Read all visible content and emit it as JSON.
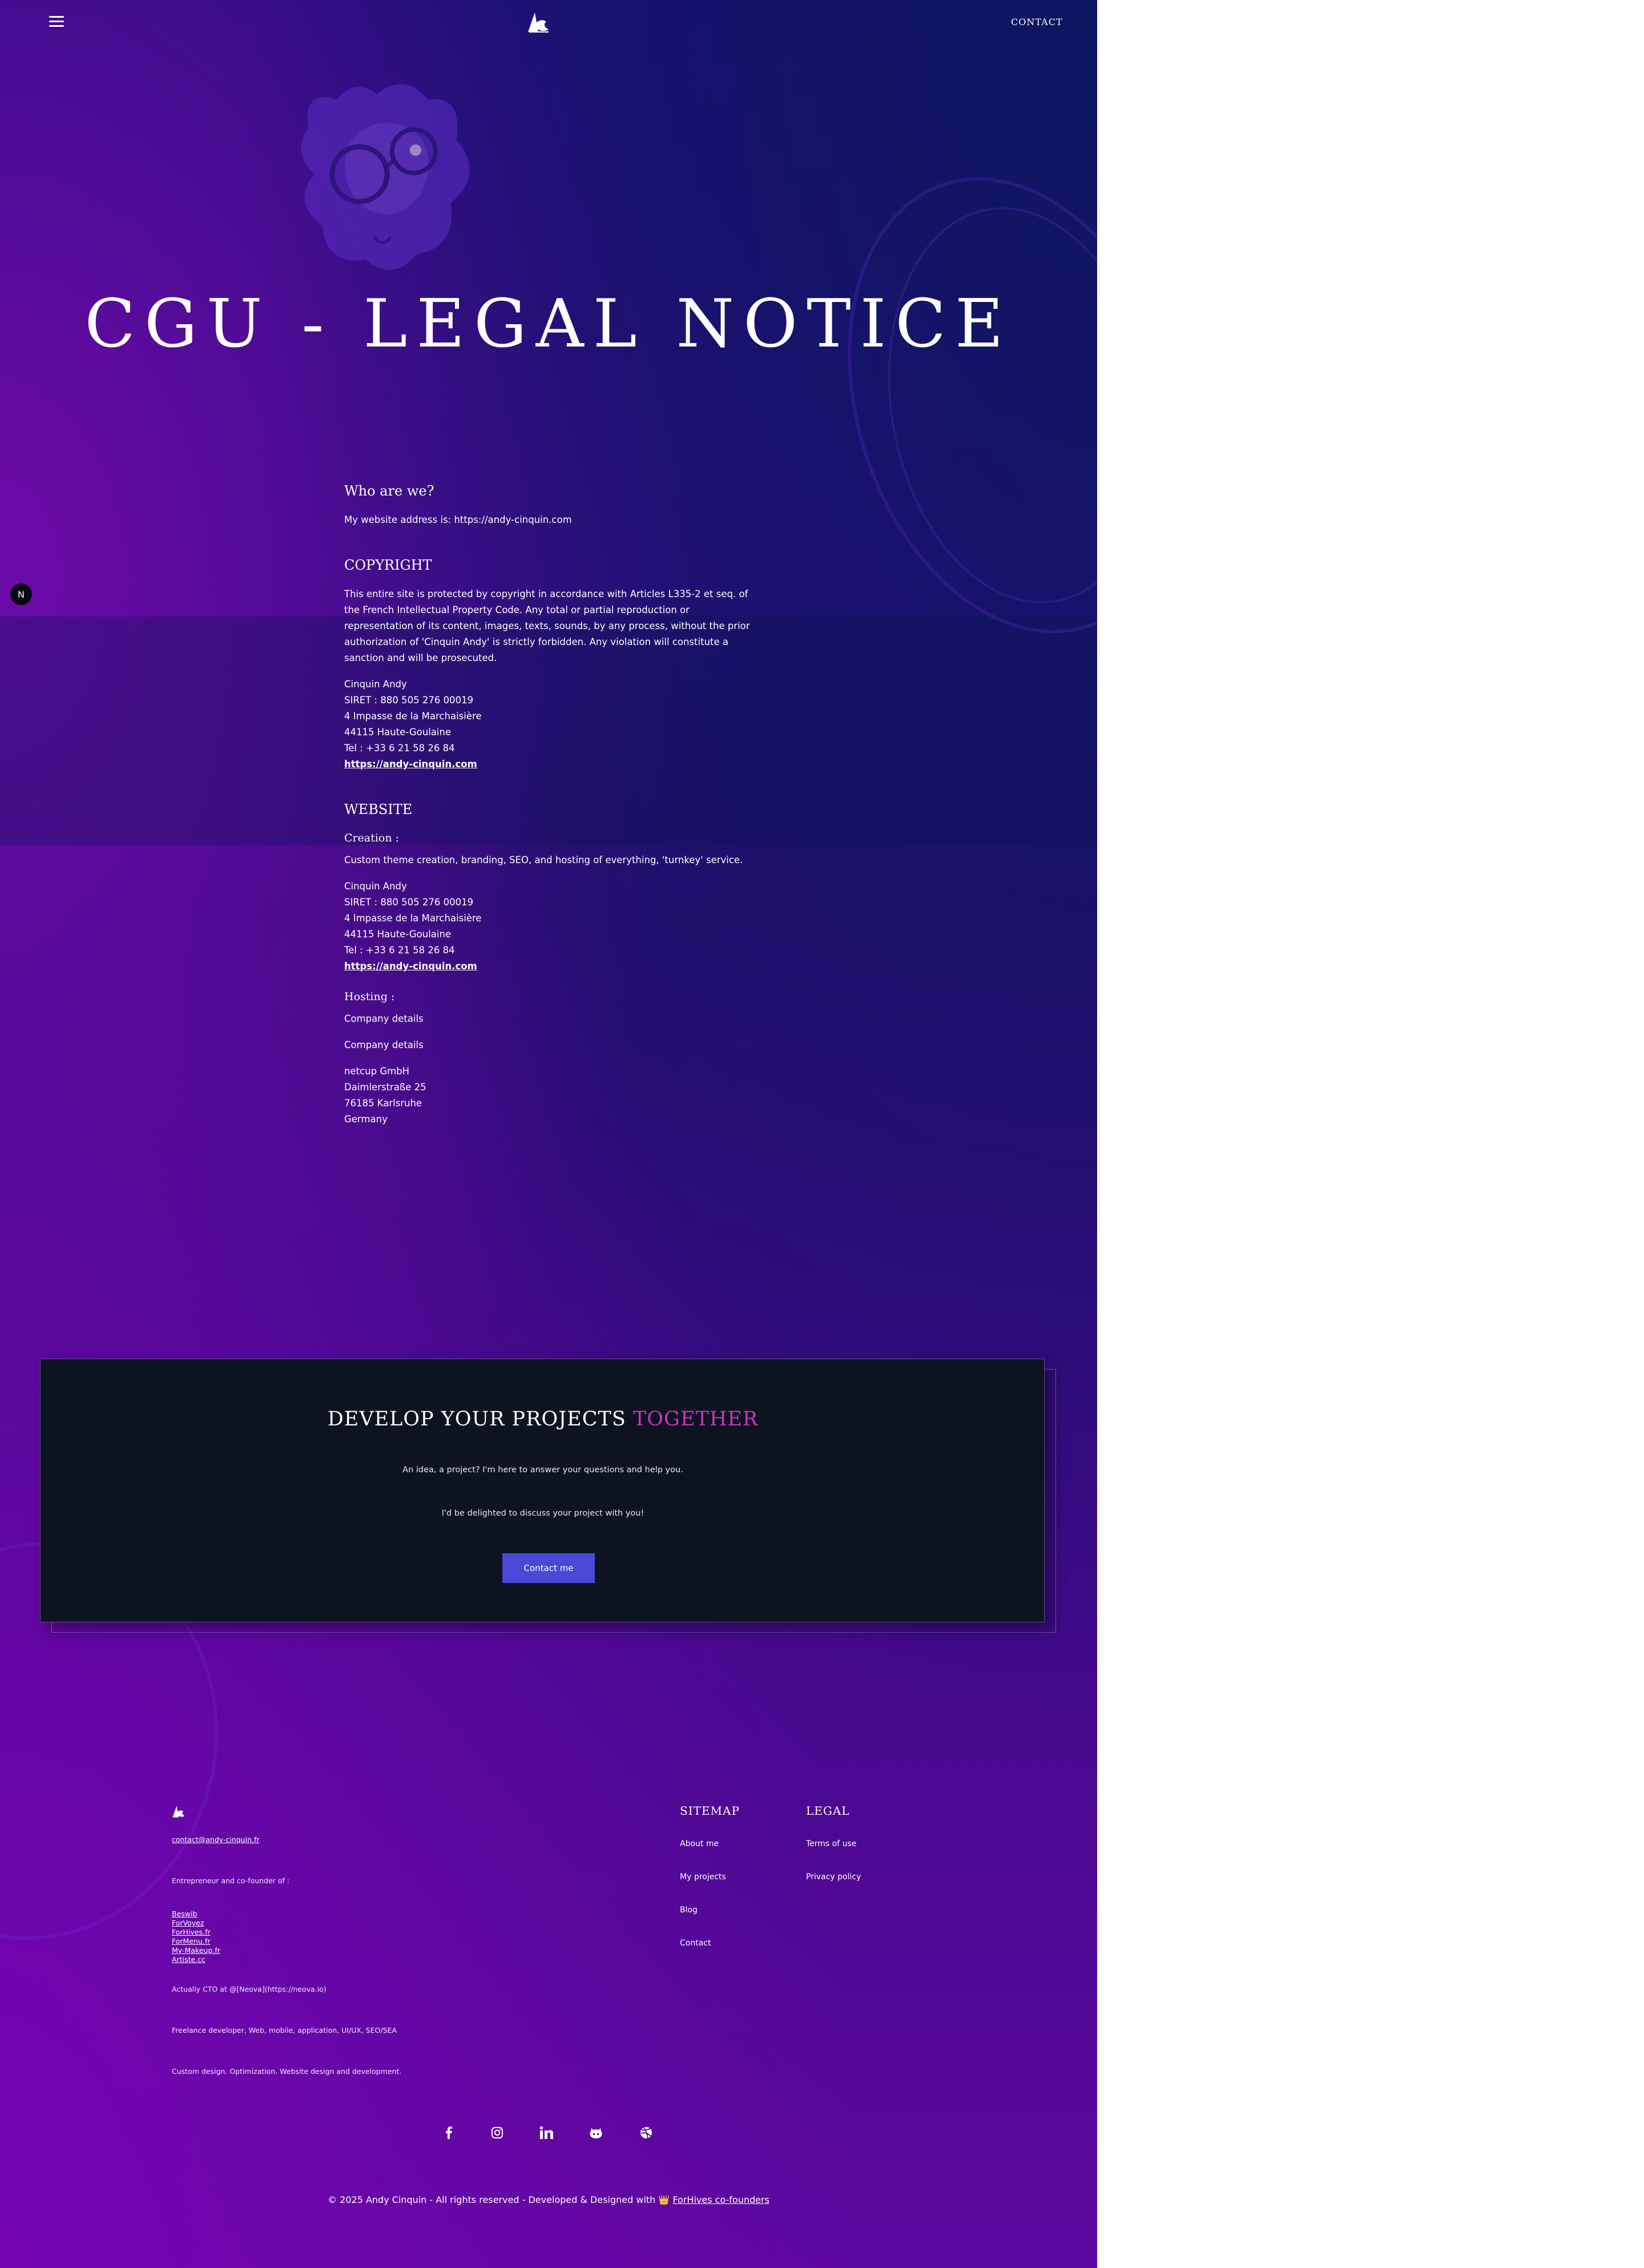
{
  "header": {
    "menu_icon": "hamburger-icon",
    "logo_icon": "ac-logo-icon",
    "contact_label": "CONTACT"
  },
  "hero": {
    "title": "CGU - LEGAL NOTICE"
  },
  "sections": {
    "who": {
      "heading": "Who are we?",
      "text": "My website address is: https://andy-cinquin.com"
    },
    "copyright": {
      "heading": "COPYRIGHT",
      "text": "This entire site is protected by copyright in accordance with Articles L335-2 et seq. of the French Intellectual Property Code. Any total or partial reproduction or representation of its content, images, texts, sounds, by any process, without the prior authorization of 'Cinquin Andy' is strictly forbidden. Any violation will constitute a sanction and will be prosecuted.",
      "name": "Cinquin Andy",
      "siret": "SIRET : 880 505 276 00019",
      "street": "4 Impasse de la Marchaisière",
      "city": "44115 Haute-Goulaine",
      "tel": "Tel : +33 6 21 58 26 84",
      "url": "https://andy-cinquin.com"
    },
    "website": {
      "heading": "WEBSITE",
      "creation_heading": "Creation :",
      "creation_text": "Custom theme creation, branding, SEO, and hosting of everything, 'turnkey' service.",
      "name": "Cinquin Andy",
      "siret": "SIRET : 880 505 276 00019",
      "street": "4 Impasse de la Marchaisière",
      "city": "44115 Haute-Goulaine",
      "tel": "Tel : +33 6 21 58 26 84",
      "url": "https://andy-cinquin.com",
      "hosting_heading": "Hosting :",
      "company_details_1": "Company details",
      "company_details_2": "Company details",
      "host_name": "netcup GmbH",
      "host_street": "Daimlerstraße 25",
      "host_city": "76185 Karlsruhe",
      "host_country": "Germany"
    }
  },
  "floating_badge": "N",
  "cta": {
    "title_main": "DEVELOP YOUR PROJECTS ",
    "title_accent": "TOGETHER",
    "line1": "An idea, a project? I'm here to answer your questions and help you.",
    "line2": "I'd be delighted to discuss your project with you!",
    "button_label": "Contact me"
  },
  "footer": {
    "email": "contact@andy-cinquin.fr",
    "cofounder_label": "Entrepreneur and co-founder of :",
    "ventures": [
      "Beswib",
      "ForVoyez",
      "ForHives.fr",
      "ForMenu.fr",
      "My-Makeup.fr",
      "Artiste.cc"
    ],
    "cto_line": "Actually CTO at @[Neova](https://neova.io)",
    "freelance_line": "Freelance developer, Web, mobile, application, UI/UX, SEO/SEA",
    "design_line": "Custom design. Optimization. Website design and development.",
    "sitemap": {
      "heading": "SITEMAP",
      "links": [
        "About me",
        "My projects",
        "Blog",
        "Contact"
      ]
    },
    "legal": {
      "heading": "LEGAL",
      "links": [
        "Terms of use",
        "Privacy policy"
      ]
    },
    "social_icons": [
      "facebook-icon",
      "instagram-icon",
      "linkedin-icon",
      "github-icon",
      "dribbble-icon"
    ],
    "copyright_text": "© 2025 Andy Cinquin - All rights reserved - Developed & Designed with 👑 ",
    "copyright_link": "ForHives co-founders"
  },
  "colors": {
    "accent": "#c935c0",
    "button": "#4b48d8",
    "cta_background": "#0e1320"
  }
}
